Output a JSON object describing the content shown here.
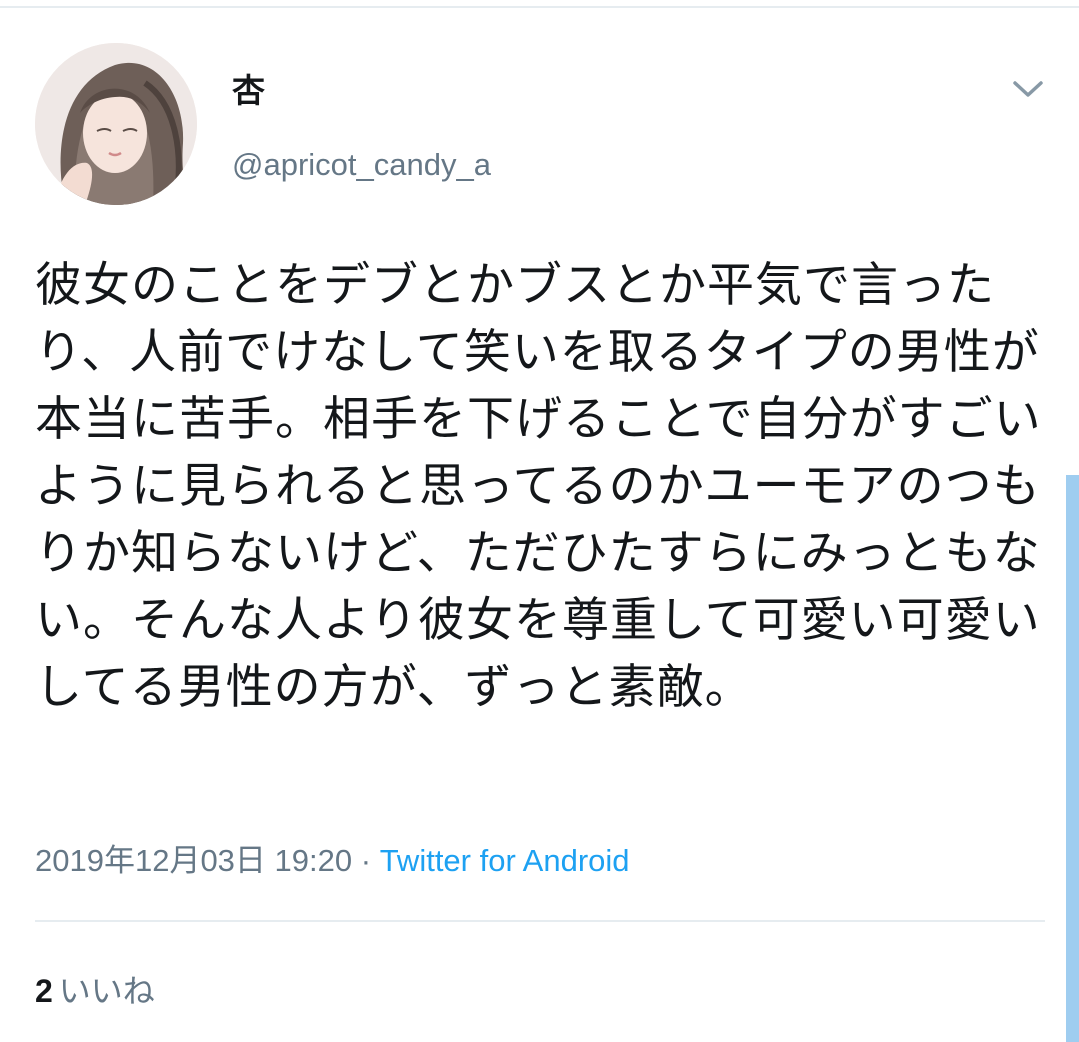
{
  "tweet": {
    "author": {
      "name": "杏",
      "handle": "@apricot_candy_a"
    },
    "text": "彼女のことをデブとかブスとか平気で言ったり、人前でけなして笑いを取るタイプの男性が本当に苦手。相手を下げることで自分がすごいように見られると思ってるのかユーモアのつもりか知らないけど、ただひたすらにみっともない。そんな人より彼女を尊重して可愛い可愛いしてる男性の方が、ずっと素敵。",
    "timestamp": "2019年12月03日 19:20",
    "separator": "·",
    "source": "Twitter for Android",
    "likes": {
      "count": "2",
      "label": "いいね"
    }
  },
  "icons": {
    "menu": "chevron-down-icon",
    "avatar": "avatar-illustration"
  },
  "colors": {
    "text": "#14171a",
    "secondary": "#657786",
    "link": "#1da1f2",
    "divider": "#e6ecf0"
  }
}
